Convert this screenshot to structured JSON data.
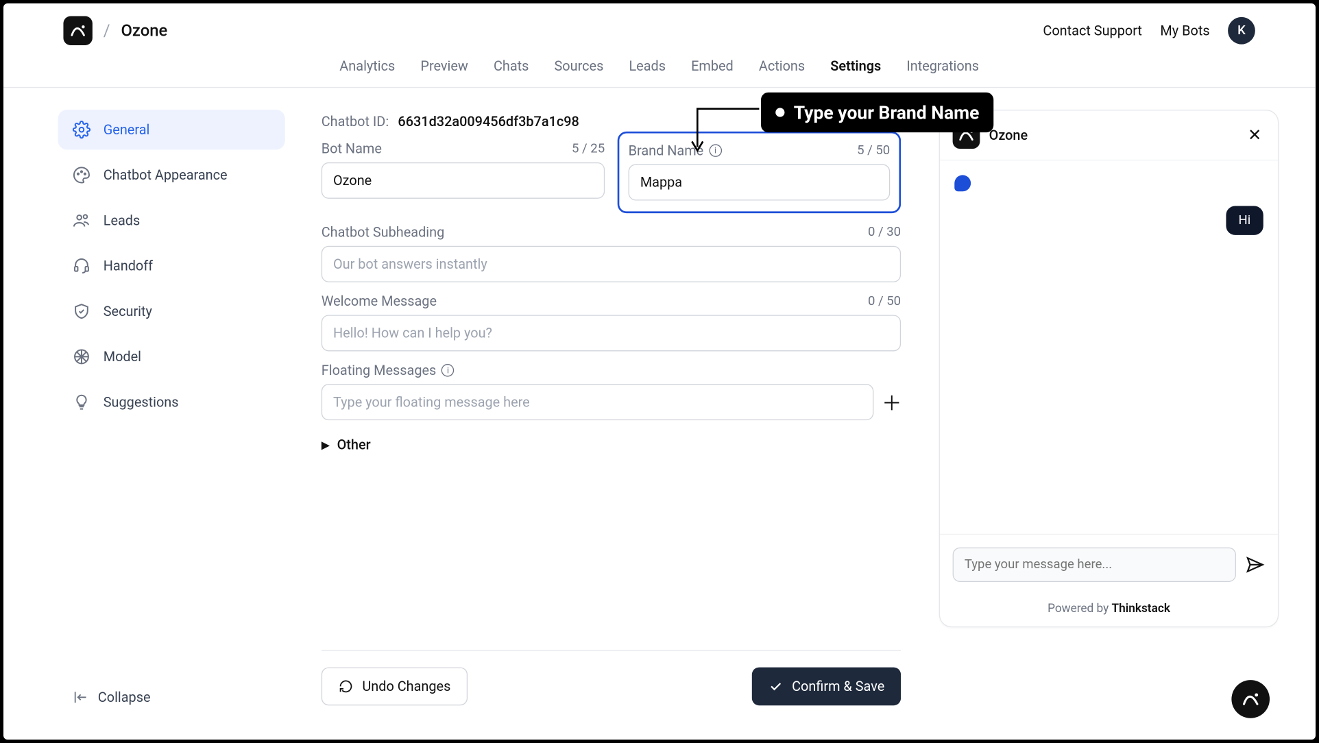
{
  "header": {
    "bot_title": "Ozone",
    "contact_support": "Contact Support",
    "my_bots": "My Bots",
    "avatar_initial": "K"
  },
  "tabs": [
    {
      "label": "Analytics",
      "active": false
    },
    {
      "label": "Preview",
      "active": false
    },
    {
      "label": "Chats",
      "active": false
    },
    {
      "label": "Sources",
      "active": false
    },
    {
      "label": "Leads",
      "active": false
    },
    {
      "label": "Embed",
      "active": false
    },
    {
      "label": "Actions",
      "active": false
    },
    {
      "label": "Settings",
      "active": true
    },
    {
      "label": "Integrations",
      "active": false
    }
  ],
  "sidebar": {
    "items": [
      {
        "label": "General",
        "icon": "gear-icon",
        "active": true
      },
      {
        "label": "Chatbot Appearance",
        "icon": "palette-icon"
      },
      {
        "label": "Leads",
        "icon": "users-icon"
      },
      {
        "label": "Handoff",
        "icon": "headset-icon"
      },
      {
        "label": "Security",
        "icon": "shield-icon"
      },
      {
        "label": "Model",
        "icon": "brain-icon"
      },
      {
        "label": "Suggestions",
        "icon": "lightbulb-icon"
      }
    ],
    "collapse_label": "Collapse"
  },
  "form": {
    "chatbot_id_label": "Chatbot ID:",
    "chatbot_id": "6631d32a009456df3b7a1c98",
    "bot_name_label": "Bot Name",
    "bot_name_value": "Ozone",
    "bot_name_counter": "5 / 25",
    "brand_name_label": "Brand Name",
    "brand_name_value": "Mappa",
    "brand_name_counter": "5 / 50",
    "subheading_label": "Chatbot Subheading",
    "subheading_placeholder": "Our bot answers instantly",
    "subheading_counter": "0 / 30",
    "welcome_label": "Welcome Message",
    "welcome_placeholder": "Hello! How can I help you?",
    "welcome_counter": "0 / 50",
    "floating_label": "Floating Messages",
    "floating_placeholder": "Type your floating message here",
    "other_label": "Other",
    "undo_label": "Undo Changes",
    "confirm_label": "Confirm & Save"
  },
  "tooltip": {
    "text": "Type your Brand Name"
  },
  "preview": {
    "title": "Ozone",
    "user_msg": "Hi",
    "input_placeholder": "Type your message here...",
    "powered_prefix": "Powered by ",
    "powered_brand": "Thinkstack"
  }
}
